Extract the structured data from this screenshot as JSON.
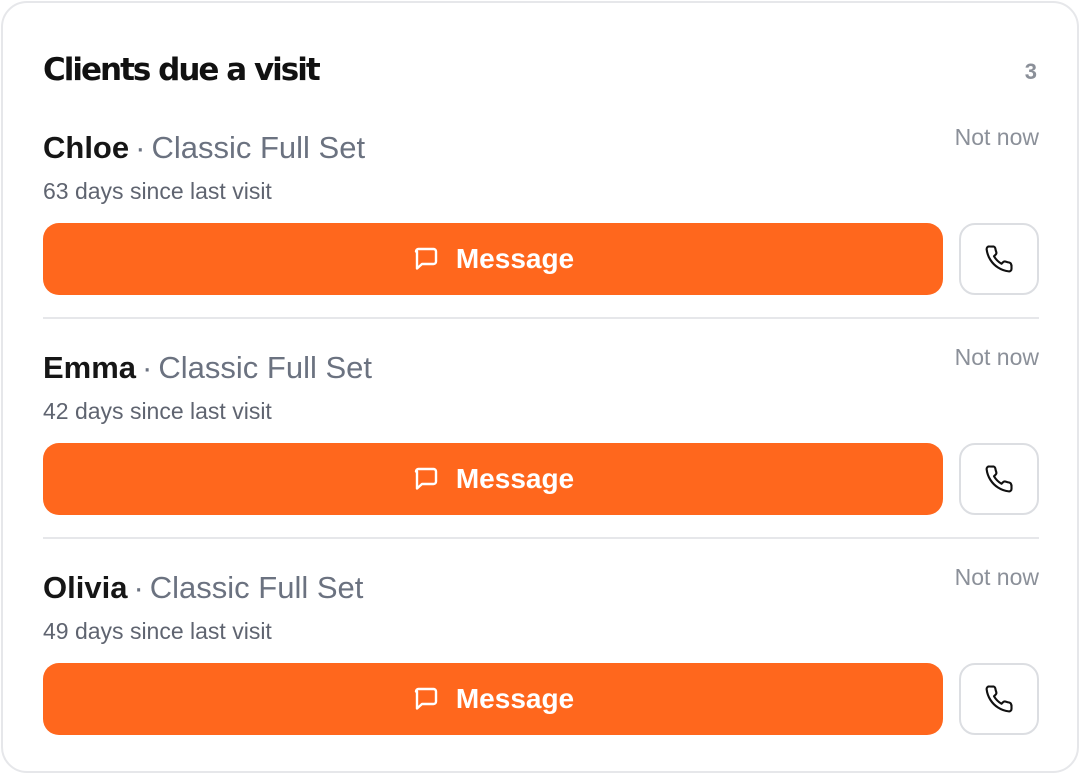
{
  "header": {
    "title": "Clients due a visit",
    "count": "3"
  },
  "clients": [
    {
      "name": "Chloe",
      "separator": "·",
      "service": "Classic Full Set",
      "days": "63 days since last visit",
      "not_now_label": "Not now",
      "message_label": "Message"
    },
    {
      "name": "Emma",
      "separator": "·",
      "service": "Classic Full Set",
      "days": "42 days since last visit",
      "not_now_label": "Not now",
      "message_label": "Message"
    },
    {
      "name": "Olivia",
      "separator": "·",
      "service": "Classic Full Set",
      "days": "49 days since last visit",
      "not_now_label": "Not now",
      "message_label": "Message"
    }
  ],
  "icons": {
    "message": "message-icon",
    "phone": "phone-icon"
  },
  "colors": {
    "accent": "#ff671d",
    "muted_text": "#8b9099",
    "secondary_text": "#6b7280"
  }
}
